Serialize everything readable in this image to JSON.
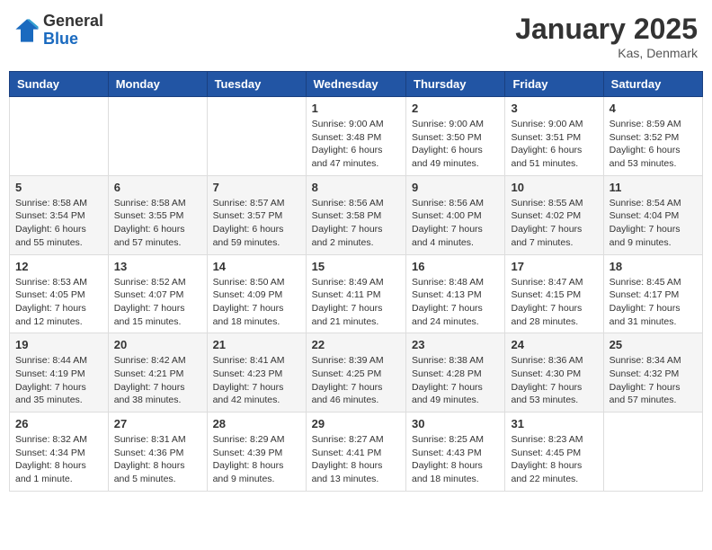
{
  "header": {
    "logo_general": "General",
    "logo_blue": "Blue",
    "month_title": "January 2025",
    "location": "Kas, Denmark"
  },
  "weekdays": [
    "Sunday",
    "Monday",
    "Tuesday",
    "Wednesday",
    "Thursday",
    "Friday",
    "Saturday"
  ],
  "weeks": [
    [
      {
        "day": "",
        "info": ""
      },
      {
        "day": "",
        "info": ""
      },
      {
        "day": "",
        "info": ""
      },
      {
        "day": "1",
        "info": "Sunrise: 9:00 AM\nSunset: 3:48 PM\nDaylight: 6 hours\nand 47 minutes."
      },
      {
        "day": "2",
        "info": "Sunrise: 9:00 AM\nSunset: 3:50 PM\nDaylight: 6 hours\nand 49 minutes."
      },
      {
        "day": "3",
        "info": "Sunrise: 9:00 AM\nSunset: 3:51 PM\nDaylight: 6 hours\nand 51 minutes."
      },
      {
        "day": "4",
        "info": "Sunrise: 8:59 AM\nSunset: 3:52 PM\nDaylight: 6 hours\nand 53 minutes."
      }
    ],
    [
      {
        "day": "5",
        "info": "Sunrise: 8:58 AM\nSunset: 3:54 PM\nDaylight: 6 hours\nand 55 minutes."
      },
      {
        "day": "6",
        "info": "Sunrise: 8:58 AM\nSunset: 3:55 PM\nDaylight: 6 hours\nand 57 minutes."
      },
      {
        "day": "7",
        "info": "Sunrise: 8:57 AM\nSunset: 3:57 PM\nDaylight: 6 hours\nand 59 minutes."
      },
      {
        "day": "8",
        "info": "Sunrise: 8:56 AM\nSunset: 3:58 PM\nDaylight: 7 hours\nand 2 minutes."
      },
      {
        "day": "9",
        "info": "Sunrise: 8:56 AM\nSunset: 4:00 PM\nDaylight: 7 hours\nand 4 minutes."
      },
      {
        "day": "10",
        "info": "Sunrise: 8:55 AM\nSunset: 4:02 PM\nDaylight: 7 hours\nand 7 minutes."
      },
      {
        "day": "11",
        "info": "Sunrise: 8:54 AM\nSunset: 4:04 PM\nDaylight: 7 hours\nand 9 minutes."
      }
    ],
    [
      {
        "day": "12",
        "info": "Sunrise: 8:53 AM\nSunset: 4:05 PM\nDaylight: 7 hours\nand 12 minutes."
      },
      {
        "day": "13",
        "info": "Sunrise: 8:52 AM\nSunset: 4:07 PM\nDaylight: 7 hours\nand 15 minutes."
      },
      {
        "day": "14",
        "info": "Sunrise: 8:50 AM\nSunset: 4:09 PM\nDaylight: 7 hours\nand 18 minutes."
      },
      {
        "day": "15",
        "info": "Sunrise: 8:49 AM\nSunset: 4:11 PM\nDaylight: 7 hours\nand 21 minutes."
      },
      {
        "day": "16",
        "info": "Sunrise: 8:48 AM\nSunset: 4:13 PM\nDaylight: 7 hours\nand 24 minutes."
      },
      {
        "day": "17",
        "info": "Sunrise: 8:47 AM\nSunset: 4:15 PM\nDaylight: 7 hours\nand 28 minutes."
      },
      {
        "day": "18",
        "info": "Sunrise: 8:45 AM\nSunset: 4:17 PM\nDaylight: 7 hours\nand 31 minutes."
      }
    ],
    [
      {
        "day": "19",
        "info": "Sunrise: 8:44 AM\nSunset: 4:19 PM\nDaylight: 7 hours\nand 35 minutes."
      },
      {
        "day": "20",
        "info": "Sunrise: 8:42 AM\nSunset: 4:21 PM\nDaylight: 7 hours\nand 38 minutes."
      },
      {
        "day": "21",
        "info": "Sunrise: 8:41 AM\nSunset: 4:23 PM\nDaylight: 7 hours\nand 42 minutes."
      },
      {
        "day": "22",
        "info": "Sunrise: 8:39 AM\nSunset: 4:25 PM\nDaylight: 7 hours\nand 46 minutes."
      },
      {
        "day": "23",
        "info": "Sunrise: 8:38 AM\nSunset: 4:28 PM\nDaylight: 7 hours\nand 49 minutes."
      },
      {
        "day": "24",
        "info": "Sunrise: 8:36 AM\nSunset: 4:30 PM\nDaylight: 7 hours\nand 53 minutes."
      },
      {
        "day": "25",
        "info": "Sunrise: 8:34 AM\nSunset: 4:32 PM\nDaylight: 7 hours\nand 57 minutes."
      }
    ],
    [
      {
        "day": "26",
        "info": "Sunrise: 8:32 AM\nSunset: 4:34 PM\nDaylight: 8 hours\nand 1 minute."
      },
      {
        "day": "27",
        "info": "Sunrise: 8:31 AM\nSunset: 4:36 PM\nDaylight: 8 hours\nand 5 minutes."
      },
      {
        "day": "28",
        "info": "Sunrise: 8:29 AM\nSunset: 4:39 PM\nDaylight: 8 hours\nand 9 minutes."
      },
      {
        "day": "29",
        "info": "Sunrise: 8:27 AM\nSunset: 4:41 PM\nDaylight: 8 hours\nand 13 minutes."
      },
      {
        "day": "30",
        "info": "Sunrise: 8:25 AM\nSunset: 4:43 PM\nDaylight: 8 hours\nand 18 minutes."
      },
      {
        "day": "31",
        "info": "Sunrise: 8:23 AM\nSunset: 4:45 PM\nDaylight: 8 hours\nand 22 minutes."
      },
      {
        "day": "",
        "info": ""
      }
    ]
  ]
}
